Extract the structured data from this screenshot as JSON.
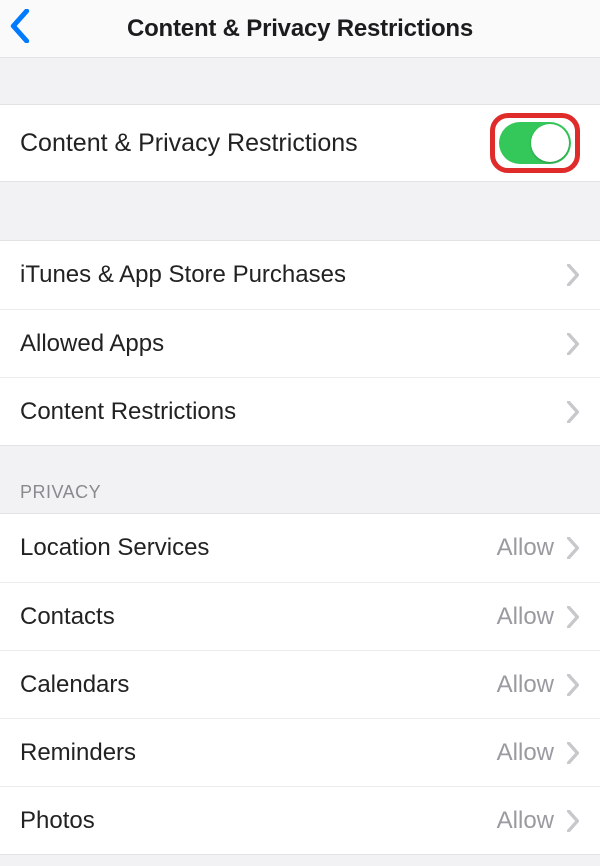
{
  "header": {
    "title": "Content & Privacy Restrictions"
  },
  "main_toggle": {
    "label": "Content & Privacy Restrictions",
    "value": true
  },
  "group1": {
    "items": [
      {
        "label": "iTunes & App Store Purchases"
      },
      {
        "label": "Allowed Apps"
      },
      {
        "label": "Content Restrictions"
      }
    ]
  },
  "privacy": {
    "heading": "PRIVACY",
    "items": [
      {
        "label": "Location Services",
        "value": "Allow"
      },
      {
        "label": "Contacts",
        "value": "Allow"
      },
      {
        "label": "Calendars",
        "value": "Allow"
      },
      {
        "label": "Reminders",
        "value": "Allow"
      },
      {
        "label": "Photos",
        "value": "Allow"
      }
    ]
  }
}
